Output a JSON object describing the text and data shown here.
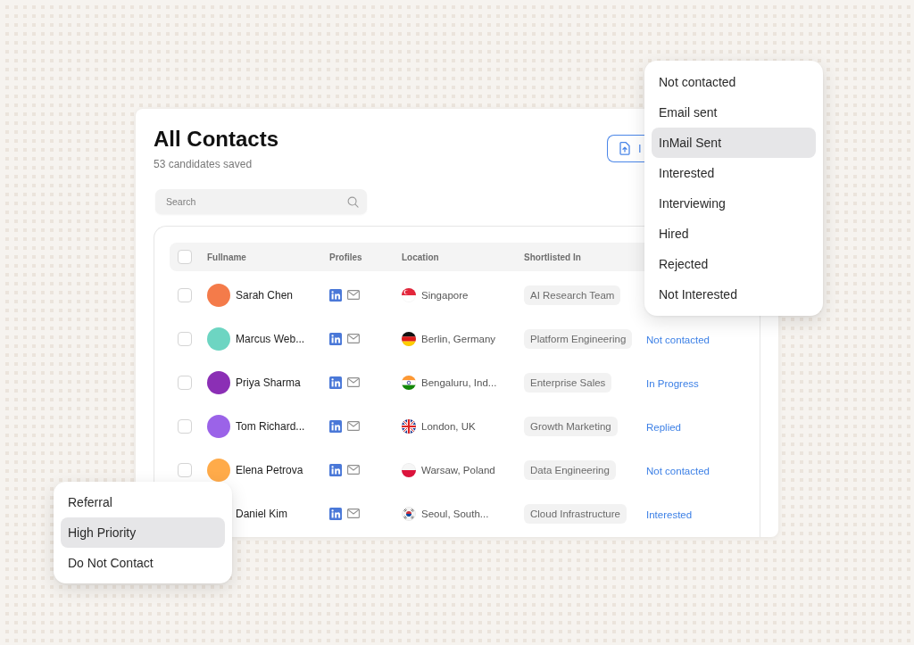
{
  "status_menu": {
    "items": [
      {
        "label": "Not contacted",
        "selected": false
      },
      {
        "label": "Email sent",
        "selected": false
      },
      {
        "label": "InMail Sent",
        "selected": true
      },
      {
        "label": "Interested",
        "selected": false
      },
      {
        "label": "Interviewing",
        "selected": false
      },
      {
        "label": "Hired",
        "selected": false
      },
      {
        "label": "Rejected",
        "selected": false
      },
      {
        "label": "Not Interested",
        "selected": false
      }
    ]
  },
  "header": {
    "title": "All Contacts",
    "subtitle": "53 candidates saved",
    "action_button": {
      "label": "I"
    }
  },
  "search": {
    "placeholder": "Search"
  },
  "table": {
    "select_all": {
      "checked": false
    },
    "columns": [
      "Fullname",
      "Profiles",
      "Location",
      "Shortlisted In"
    ],
    "rows": [
      {
        "checked": false,
        "avatar": {
          "color": "#f47b4a"
        },
        "fullname": "Sarah Chen",
        "flag": {
          "kind": "singapore"
        },
        "location": "Singapore",
        "shortlisted_in": "AI Research Team"
      },
      {
        "checked": false,
        "avatar": {
          "color": "#6dd5c2"
        },
        "fullname": "Marcus Web...",
        "flag": {
          "kind": "germany"
        },
        "location": "Berlin, Germany",
        "shortlisted_in": "Platform Engineering",
        "column_5": "Not contacted"
      },
      {
        "checked": false,
        "avatar": {
          "color": "#8b2fb5"
        },
        "fullname": "Priya Sharma",
        "flag": {
          "kind": "india"
        },
        "location": "Bengaluru, Ind...",
        "shortlisted_in": "Enterprise Sales",
        "column_5": "In Progress"
      },
      {
        "checked": false,
        "avatar": {
          "color": "#9b63e8"
        },
        "fullname": "Tom Richard...",
        "flag": {
          "kind": "uk"
        },
        "location": "London, UK",
        "shortlisted_in": "Growth Marketing",
        "column_5": "Replied"
      },
      {
        "checked": false,
        "avatar": {
          "color": "#ffab4a"
        },
        "fullname": "Elena Petrova",
        "flag": {
          "kind": "poland"
        },
        "location": "Warsaw, Poland",
        "shortlisted_in": "Data Engineering",
        "column_5": "Not contacted"
      },
      {
        "fullname": "Daniel Kim",
        "flag": {
          "kind": "south-korea"
        },
        "location": "Seoul, South...",
        "shortlisted_in": "Cloud Infrastructure",
        "column_5": "Interested"
      }
    ]
  },
  "tag_menu": {
    "items": [
      {
        "label": "Referral",
        "selected": false
      },
      {
        "label": "High Priority",
        "selected": true
      },
      {
        "label": "Do Not Contact",
        "selected": false
      }
    ]
  }
}
